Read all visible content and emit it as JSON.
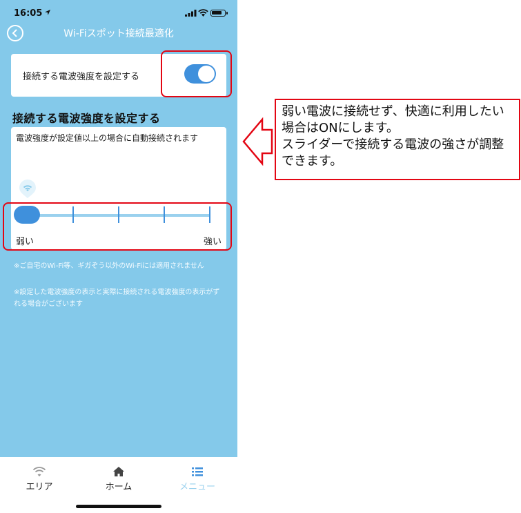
{
  "status": {
    "time": "16:05"
  },
  "nav": {
    "title": "Wi-Fiスポット接続最適化"
  },
  "toggle_card": {
    "label": "接続する電波強度を設定する",
    "switch_on": true
  },
  "section": {
    "heading": "接続する電波強度を設定する"
  },
  "slider_card": {
    "description": "電波強度が設定値以上の場合に自動接続されます",
    "min_label": "弱い",
    "max_label": "強い",
    "level": 1,
    "steps": 5
  },
  "notes": [
    "※ご自宅のWi-Fi等、ギガぞう以外のWi-Fiには適用されません",
    "※設定した電波強度の表示と実際に接続される電波強度の表示がずれる場合がございます"
  ],
  "tabs": [
    {
      "label": "エリア",
      "icon": "wifi-icon",
      "active": false
    },
    {
      "label": "ホーム",
      "icon": "home-icon",
      "active": false
    },
    {
      "label": "メニュー",
      "icon": "menu-list-icon",
      "active": true
    }
  ],
  "callout": {
    "text": "弱い電波に接続せず、快適に利用したい場合はONにします。\nスライダーで接続する電波の強さが調整できます。"
  },
  "colors": {
    "background": "#84c9ea",
    "accent": "#3f90dc",
    "highlight": "#e30613",
    "tab_active": "#9ad1ee"
  }
}
